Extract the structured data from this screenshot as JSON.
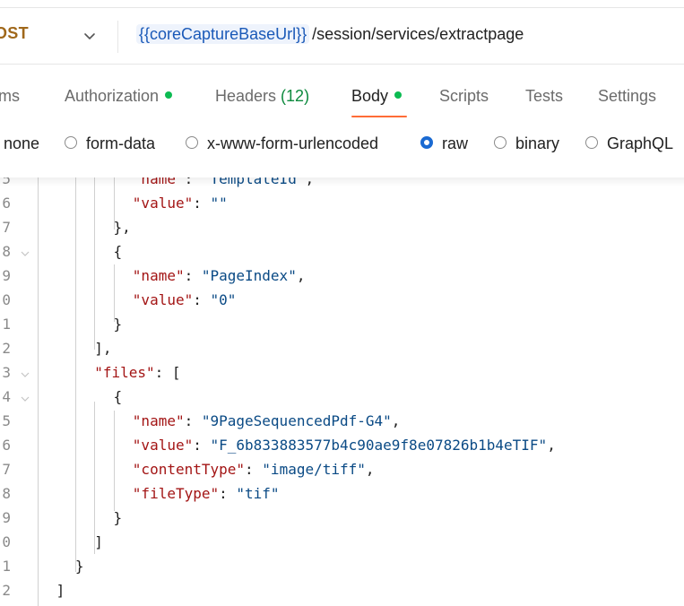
{
  "request": {
    "method": "OST",
    "url_variable": "{{coreCaptureBaseUrl}}",
    "url_path": "/session/services/extractpage"
  },
  "tabs": [
    {
      "label": "rams",
      "dot": false
    },
    {
      "label": "Authorization",
      "dot": true
    },
    {
      "label": "Headers ",
      "count": "(12)"
    },
    {
      "label": "Body",
      "dot": true,
      "active": true
    },
    {
      "label": "Scripts"
    },
    {
      "label": "Tests"
    },
    {
      "label": "Settings"
    }
  ],
  "body_modes": [
    {
      "label": "none",
      "selected": false
    },
    {
      "label": "form-data",
      "selected": false
    },
    {
      "label": "x-www-form-urlencoded",
      "selected": false
    },
    {
      "label": "raw",
      "selected": true
    },
    {
      "label": "binary",
      "selected": false
    },
    {
      "label": "GraphQL",
      "selected": false
    }
  ],
  "editor": {
    "lines": [
      {
        "n": "5",
        "indent": 6,
        "code": [
          [
            "k",
            "\"name\""
          ],
          [
            "p",
            ": "
          ],
          [
            "s",
            "\"TemplateId\""
          ],
          [
            "p",
            ","
          ]
        ],
        "partial": true
      },
      {
        "n": "6",
        "indent": 6,
        "code": [
          [
            "k",
            "\"value\""
          ],
          [
            "p",
            ": "
          ],
          [
            "s",
            "\"\""
          ]
        ]
      },
      {
        "n": "7",
        "indent": 5,
        "code": [
          [
            "p",
            "},"
          ]
        ]
      },
      {
        "n": "8",
        "indent": 5,
        "code": [
          [
            "p",
            "{"
          ]
        ],
        "fold": true
      },
      {
        "n": "9",
        "indent": 6,
        "code": [
          [
            "k",
            "\"name\""
          ],
          [
            "p",
            ": "
          ],
          [
            "s",
            "\"PageIndex\""
          ],
          [
            "p",
            ","
          ]
        ]
      },
      {
        "n": "0",
        "indent": 6,
        "code": [
          [
            "k",
            "\"value\""
          ],
          [
            "p",
            ": "
          ],
          [
            "s",
            "\"0\""
          ]
        ]
      },
      {
        "n": "1",
        "indent": 5,
        "code": [
          [
            "p",
            "}"
          ]
        ]
      },
      {
        "n": "2",
        "indent": 4,
        "code": [
          [
            "p",
            "],"
          ]
        ]
      },
      {
        "n": "3",
        "indent": 4,
        "code": [
          [
            "k",
            "\"files\""
          ],
          [
            "p",
            ": ["
          ]
        ],
        "fold": true
      },
      {
        "n": "4",
        "indent": 5,
        "code": [
          [
            "p",
            "{"
          ]
        ],
        "fold": true
      },
      {
        "n": "5",
        "indent": 6,
        "code": [
          [
            "k",
            "\"name\""
          ],
          [
            "p",
            ": "
          ],
          [
            "s",
            "\"9PageSequencedPdf-G4\""
          ],
          [
            "p",
            ","
          ]
        ]
      },
      {
        "n": "6",
        "indent": 6,
        "code": [
          [
            "k",
            "\"value\""
          ],
          [
            "p",
            ": "
          ],
          [
            "s",
            "\"F_6b833883577b4c90ae9f8e07826b1b4eTIF\""
          ],
          [
            "p",
            ","
          ]
        ]
      },
      {
        "n": "7",
        "indent": 6,
        "code": [
          [
            "k",
            "\"contentType\""
          ],
          [
            "p",
            ": "
          ],
          [
            "s",
            "\"image/tiff\""
          ],
          [
            "p",
            ","
          ]
        ]
      },
      {
        "n": "8",
        "indent": 6,
        "code": [
          [
            "k",
            "\"fileType\""
          ],
          [
            "p",
            ": "
          ],
          [
            "s",
            "\"tif\""
          ]
        ]
      },
      {
        "n": "9",
        "indent": 5,
        "code": [
          [
            "p",
            "}"
          ]
        ]
      },
      {
        "n": "0",
        "indent": 4,
        "code": [
          [
            "p",
            "]"
          ]
        ]
      },
      {
        "n": "1",
        "indent": 3,
        "code": [
          [
            "p",
            "}"
          ]
        ]
      },
      {
        "n": "2",
        "indent": 2,
        "code": [
          [
            "p",
            "]"
          ]
        ]
      }
    ]
  }
}
